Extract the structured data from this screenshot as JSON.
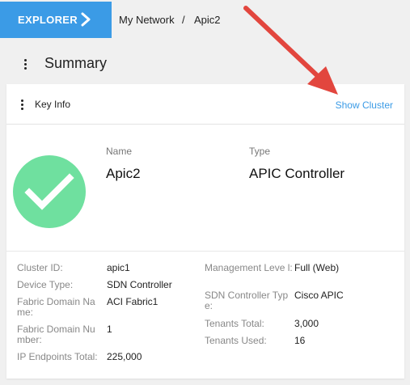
{
  "header": {
    "explorer_label": "EXPLORER",
    "breadcrumb": [
      "My Network",
      "Apic2"
    ],
    "separator": "/"
  },
  "summary": {
    "title": "Summary"
  },
  "key_info": {
    "title": "Key Info",
    "show_cluster_label": "Show Cluster",
    "name_label": "Name",
    "name_value": "Apic2",
    "type_label": "Type",
    "type_value": "APIC Controller",
    "status": "ok"
  },
  "details_left": [
    {
      "label": "Cluster ID:",
      "value": "apic1"
    },
    {
      "label": "Device Type:",
      "value": "SDN Controller"
    },
    {
      "label": "Fabric Domain Na me:",
      "value": "ACI Fabric1"
    },
    {
      "label": "Fabric Domain Nu mber:",
      "value": "1"
    },
    {
      "label": "IP Endpoints Total:",
      "value": "225,000"
    }
  ],
  "details_right": [
    {
      "label": "Management Leve l:",
      "value": "Full (Web)"
    },
    {
      "label": "SDN Controller Typ e:",
      "value": "Cisco APIC"
    },
    {
      "label": "Tenants Total:",
      "value": "3,000"
    },
    {
      "label": "Tenants Used:",
      "value": "16"
    }
  ],
  "colors": {
    "accent": "#3b9be6",
    "status_ok": "#6fe09f",
    "annotation_arrow": "#e2463e"
  }
}
